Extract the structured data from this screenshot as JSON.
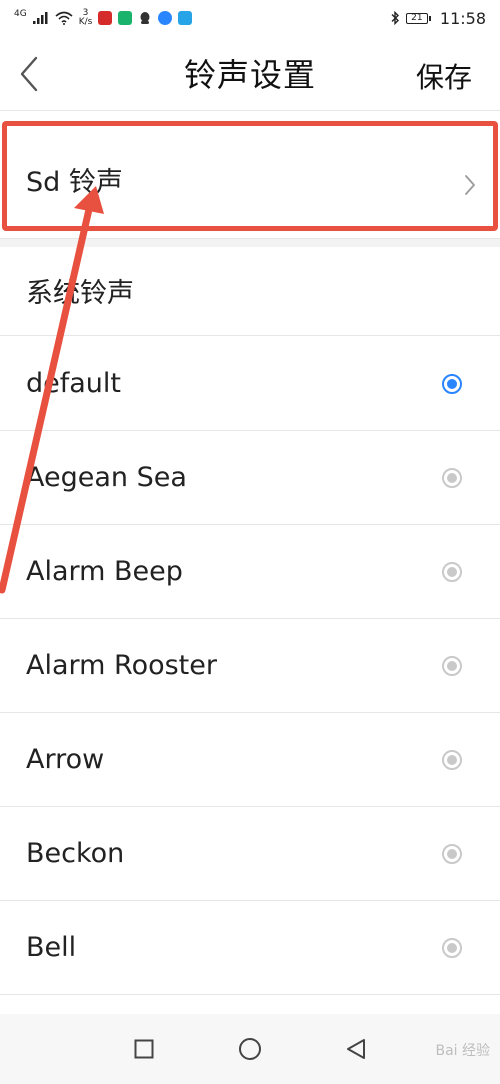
{
  "status_bar": {
    "network": "4G",
    "speed_value": "3",
    "speed_unit": "K/s",
    "battery": "21",
    "time": "11:58"
  },
  "header": {
    "title": "铃声设置",
    "save_label": "保存"
  },
  "sd_ringtone": {
    "label": "Sd 铃声"
  },
  "system_section": {
    "title": "系统铃声"
  },
  "ringtones": [
    {
      "label": "default",
      "selected": true
    },
    {
      "label": "Aegean Sea",
      "selected": false
    },
    {
      "label": "Alarm Beep",
      "selected": false
    },
    {
      "label": "Alarm Rooster",
      "selected": false
    },
    {
      "label": "Arrow",
      "selected": false
    },
    {
      "label": "Beckon",
      "selected": false
    },
    {
      "label": "Bell",
      "selected": false
    }
  ],
  "colors": {
    "annotation": "#e8503f",
    "accent": "#2a86ff",
    "radio_inactive": "#c9c9c9"
  },
  "watermark": "Bai 经验"
}
